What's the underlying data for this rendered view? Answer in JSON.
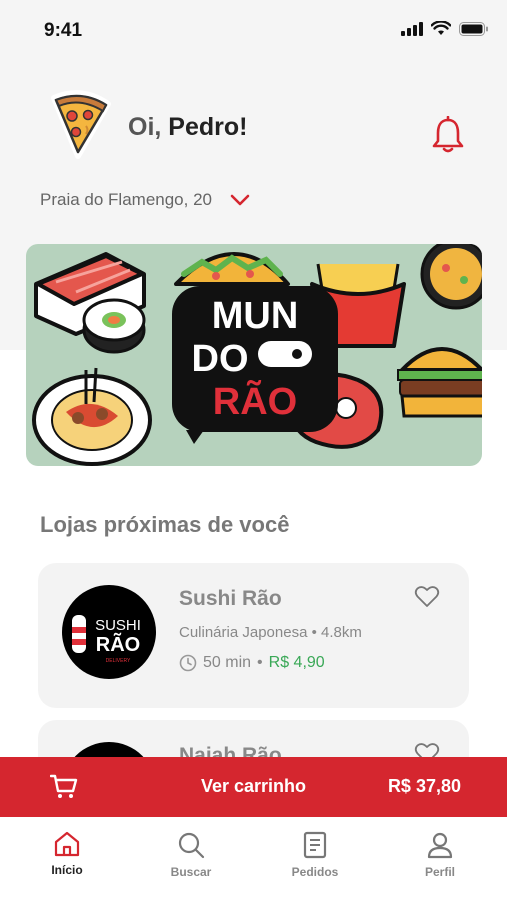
{
  "status": {
    "time": "9:41"
  },
  "header": {
    "greeting_prefix": "Oi,",
    "user_name": "Pedro!",
    "address": "Praia do Flamengo, 20"
  },
  "banner": {
    "logo_line1": "MUN",
    "logo_line2": "DO",
    "logo_line3": "RÃO"
  },
  "section": {
    "title": "Lojas próximas de você"
  },
  "stores": [
    {
      "name": "Sushi Rão",
      "cuisine": "Culinária Japonesa",
      "distance": "4.8km",
      "eta": "50 min",
      "delivery_fee": "R$ 4,90",
      "logo_text_top": "SUSHI",
      "logo_text_bottom": "RÃO",
      "logo_text_sub": "DELIVERY"
    },
    {
      "name": "Naiah Rão"
    }
  ],
  "cart": {
    "label": "Ver carrinho",
    "total": "R$ 37,80"
  },
  "tabs": [
    {
      "label": "Início"
    },
    {
      "label": "Buscar"
    },
    {
      "label": "Pedidos"
    },
    {
      "label": "Perfil"
    }
  ],
  "colors": {
    "accent": "#d5262f",
    "price": "#3aa857",
    "banner_bg": "#b6d2bd"
  }
}
